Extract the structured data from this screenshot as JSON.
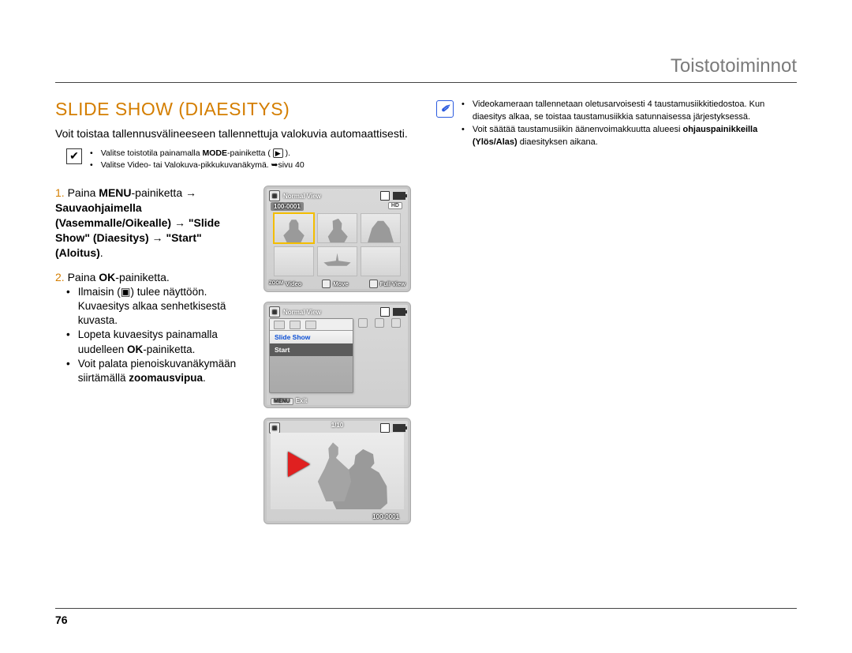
{
  "header": {
    "chapter": "Toistotoiminnot"
  },
  "page_number": "76",
  "title": "SLIDE SHOW (DIAESITYS)",
  "intro": "Voit toistaa tallennusvälineeseen tallennettuja valokuvia automaattisesti.",
  "precheck": {
    "line1_a": "Valitse toistotila painamalla ",
    "line1_b": "MODE",
    "line1_c": "-painiketta (",
    "line1_d": ").",
    "play_glyph": "▶",
    "line2_a": "Valitse Video- tai Valokuva-pikkukuvanäkymä. ",
    "line2_arrow": "➥",
    "line2_b": "sivu 40"
  },
  "steps": {
    "s1_a": "Paina ",
    "s1_b": "MENU",
    "s1_c": "-painiketta → ",
    "s1_d": "Sauvaohjaimella (Vasemmalle/Oikealle) → \"Slide Show\" (Diaesitys) → \"Start\" (Aloitus)",
    "s1_e": ".",
    "s2_a": "Paina ",
    "s2_b": "OK",
    "s2_c": "-painiketta.",
    "s2_sub1_a": "Ilmaisin (",
    "s2_sub1_icon": "▣",
    "s2_sub1_b": ") tulee näyttöön. Kuvaesitys alkaa senhetkisestä kuvasta.",
    "s2_sub2_a": "Lopeta kuvaesitys painamalla uudelleen ",
    "s2_sub2_b": "OK",
    "s2_sub2_c": "-painiketta.",
    "s2_sub3_a": "Voit palata pienoiskuvanäkymään siirtämällä ",
    "s2_sub3_b": "zoomausvipua",
    "s2_sub3_c": "."
  },
  "screens": {
    "s1": {
      "title": "Normal View",
      "folder": "100-0001",
      "hd": "HD",
      "bottom_left_icon": "ZOOM",
      "bottom_left": "Video",
      "bottom_mid": "Move",
      "bottom_right": "Full View"
    },
    "s2": {
      "title": "Normal View",
      "menu_item": "Slide Show",
      "menu_sub": "Start",
      "exit_chip": "MENU",
      "exit": "Exit"
    },
    "s3": {
      "counter": "1/10",
      "file": "100-0001"
    }
  },
  "notes": {
    "n1": "Videokameraan tallennetaan oletusarvoisesti 4 taustamusiikkitiedostoa. Kun diaesitys alkaa, se toistaa taustamusiikkia satunnaisessa järjestyksessä.",
    "n2_a": "Voit säätää taustamusiikin äänenvoimakkuutta alueesi ",
    "n2_b": "ohjauspainikkeilla (Ylös/Alas)",
    "n2_c": " diaesityksen aikana."
  }
}
